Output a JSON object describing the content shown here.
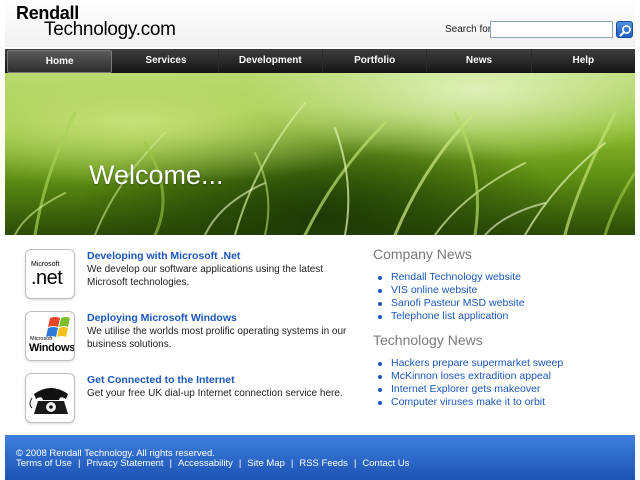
{
  "header": {
    "logo_line1": "Rendall",
    "logo_line2": "Technology.com",
    "search_label": "Search for:",
    "search_value": ""
  },
  "nav": {
    "items": [
      {
        "label": "Home",
        "active": true
      },
      {
        "label": "Services"
      },
      {
        "label": "Development"
      },
      {
        "label": "Portfolio"
      },
      {
        "label": "News"
      },
      {
        "label": "Help"
      }
    ]
  },
  "hero": {
    "title": "Welcome..."
  },
  "features": [
    {
      "title": "Developing with Microsoft .Net",
      "text": "We develop our software applications using the latest Microsoft technologies.",
      "icon": "microsoft-net-logo",
      "icon_text_small": "Microsoft",
      "icon_text_large": ".net"
    },
    {
      "title": "Deploying Microsoft Windows",
      "text": "We utilise the worlds most prolific operating systems in our business solutions.",
      "icon": "windows-logo",
      "icon_text_small": "Microsoft",
      "icon_text_large": "Windows"
    },
    {
      "title": "Get Connected to the Internet",
      "text": "Get your free UK dial-up Internet connection service here.",
      "icon": "telephone-icon"
    }
  ],
  "company_news": {
    "heading": "Company News",
    "items": [
      "Rendall Technology website",
      "VIS online website",
      "Sanofi Pasteur MSD website",
      "Telephone list application"
    ]
  },
  "technology_news": {
    "heading": "Technology News",
    "items": [
      "Hackers prepare supermarket sweep",
      "McKinnon loses extradition appeal",
      "Internet Explorer gets makeover",
      "Computer viruses make it to orbit"
    ]
  },
  "footer": {
    "copyright": "© 2008 Rendall Technology. All rights reserved.",
    "links": [
      "Terms of Use",
      "Privacy Statement",
      "Accessability",
      "Site Map",
      "RSS Feeds",
      "Contact Us"
    ],
    "separator": "|"
  },
  "colors": {
    "link_blue": "#1a57b8",
    "nav_bg": "#1e1e1e",
    "footer_blue": "#2a66c9",
    "heading_gray": "#7a7a7a"
  }
}
